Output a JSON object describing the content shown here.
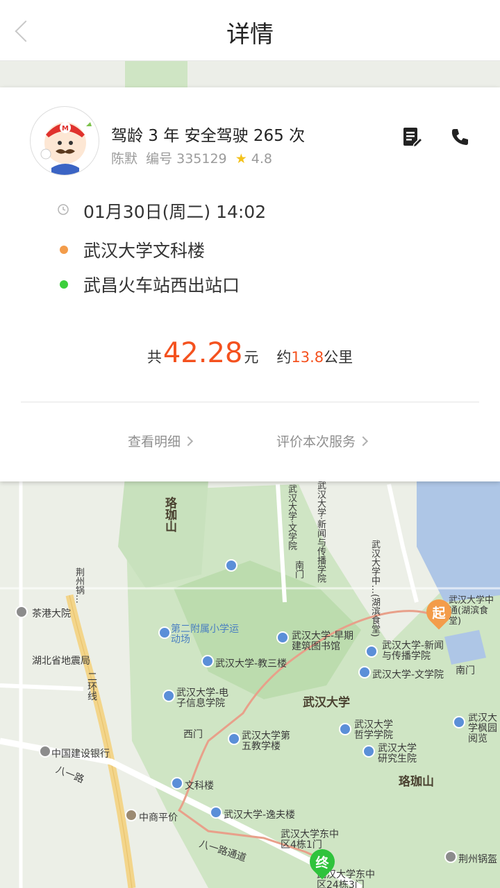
{
  "header": {
    "title": "详情"
  },
  "driver": {
    "stats": "驾龄 3 年  安全驾驶 265 次",
    "name": "陈默",
    "id_text": "编号 335129",
    "rating": "4.8"
  },
  "trip": {
    "time": "01月30日(周二) 14:02",
    "origin": "武汉大学文科楼",
    "destination": "武昌火车站西出站口",
    "origin_color": "#f39c4a",
    "destination_color": "#3ccf3c"
  },
  "fare": {
    "prefix": "共",
    "amount": "42.28",
    "unit": "元",
    "distance_prefix": "约",
    "distance": "13.8",
    "distance_unit": "公里"
  },
  "actions": {
    "view_details": "查看明细",
    "rate_service": "评价本次服务"
  },
  "map": {
    "start_label": "起",
    "end_label": "终",
    "labels_top": [
      "珞珈山",
      "武汉大学·文学院",
      "武汉大学·新闻与传播学院",
      "武汉大学中…(湖滨食堂)",
      "南门",
      "荆州锅…"
    ],
    "labels": [
      "茶港大院",
      "湖北省地震局",
      "二环线",
      "中国建设银行",
      "八一路",
      "第二附属小学运动场",
      "武汉大学-早期建筑图书馆",
      "武汉大学-新闻与传播学院",
      "武汉大学-教三楼",
      "武汉大学-文学院",
      "南门",
      "武汉大学-电子信息学院",
      "武汉大学",
      "西门",
      "武汉大学第五教学楼",
      "武汉大学哲学学院",
      "武汉大学研究生院",
      "珞珈山",
      "武汉大学枫园阅览",
      "文科楼",
      "中商平价",
      "武汉大学-逸夫楼",
      "武汉大学东中区4栋1门",
      "八一路通道",
      "武汉大学东中区24栋3门",
      "荆州锅盔",
      "武汉大学中通(湖滨食堂)"
    ]
  },
  "colors": {
    "accent": "#f4511e",
    "route": "#e8a08a"
  }
}
